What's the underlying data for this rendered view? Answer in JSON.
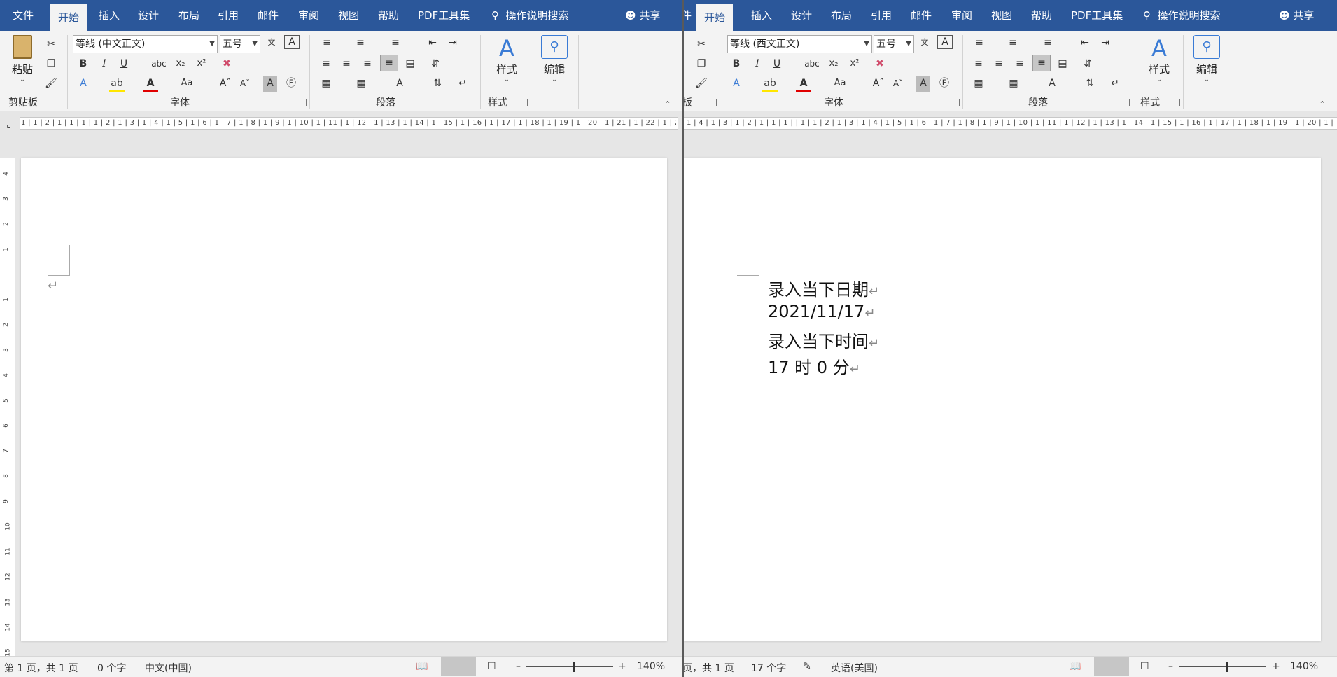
{
  "left": {
    "tabs": {
      "file": "文件",
      "home": "开始",
      "insert": "插入",
      "design": "设计",
      "layout": "布局",
      "references": "引用",
      "mailings": "邮件",
      "review": "审阅",
      "view": "视图",
      "help": "帮助",
      "pdf": "PDF工具集"
    },
    "tell_me": "操作说明搜索",
    "share": "共享",
    "font_name": "等线 (中文正文)",
    "font_size": "五号",
    "groups": {
      "clipboard": "剪贴板",
      "font": "字体",
      "paragraph": "段落",
      "styles": "样式"
    },
    "paste": "粘贴",
    "styles_btn": "样式",
    "editing_btn": "编辑",
    "ruler_ticks": "1 | 1 | 2 | 1 | 1 | 1 | 1 | 2 | 1 | 3 | 1 | 4 | 1 | 5 | 1 | 6 | 1 | 7 | 1 | 8 | 1 | 9 | 1 | 10 | 1 | 11 | 1 | 12 | 1 | 13 | 1 | 14 | 1 | 15 | 1 | 16 | 1 | 17 | 1 | 18 | 1 | 19 | 1 | 20 | 1 | 21 | 1 | 22 | 1 | 23 | 1 | 24 | 1 | 25 | 1 | 26 | 1 | 27 | 1 | 28 | 1 | 29 | 1 | 30 | 1 | 31 | 1 | 32 | 1 | 33 | 1 | 34 | 1 | 35 | 1 | 36 |",
    "status": {
      "page": "第 1 页，共 1 页",
      "words": "0 个字",
      "lang": "中文(中国)",
      "zoom": "140%"
    }
  },
  "right": {
    "tabs": {
      "home": "开始",
      "insert": "插入",
      "design": "设计",
      "layout": "布局",
      "references": "引用",
      "mailings": "邮件",
      "review": "审阅",
      "view": "视图",
      "help": "帮助",
      "pdf": "PDF工具集"
    },
    "tell_me": "操作说明搜索",
    "share": "共享",
    "font_name": "等线 (西文正文)",
    "font_size": "五号",
    "groups": {
      "clipboard": "板",
      "font": "字体",
      "paragraph": "段落",
      "styles": "样式"
    },
    "styles_btn": "样式",
    "editing_btn": "编辑",
    "ruler_ticks": "1 | 4 | 1 | 3 | 1 | 2 | 1 | 1 | 1 |     | 1 | 1 | 2 | 1 | 3 | 1 | 4 | 1 | 5 | 1 | 6 | 1 | 7 | 1 | 8 | 1 | 9 | 1 | 10 | 1 | 11 | 1 | 12 | 1 | 13 | 1 | 14 | 1 | 15 | 1 | 16 | 1 | 17 | 1 | 18 | 1 | 19 | 1 | 20 | 1 | 21 | 1 | 22 | 1 | 23 | 1 | 24 | 1 | 25 | 1 | 26 | 1 | 27 | 1 | 28 | 1 | 29 | 1 | 30 | 1 | 31 | 1 | 32 | 1 | 33",
    "doc_lines": [
      "录入当下日期",
      "2021/11/17",
      "录入当下时间",
      "17 时 0 分"
    ],
    "status": {
      "page": "页，共 1 页",
      "words": "17 个字",
      "lang": "英语(美国)",
      "zoom": "140%"
    }
  },
  "vruler_ticks": [
    "4",
    "3",
    "2",
    "1",
    "",
    "1",
    "2",
    "3",
    "4",
    "5",
    "6",
    "7",
    "8",
    "9",
    "10",
    "11",
    "12",
    "13",
    "14",
    "15"
  ]
}
